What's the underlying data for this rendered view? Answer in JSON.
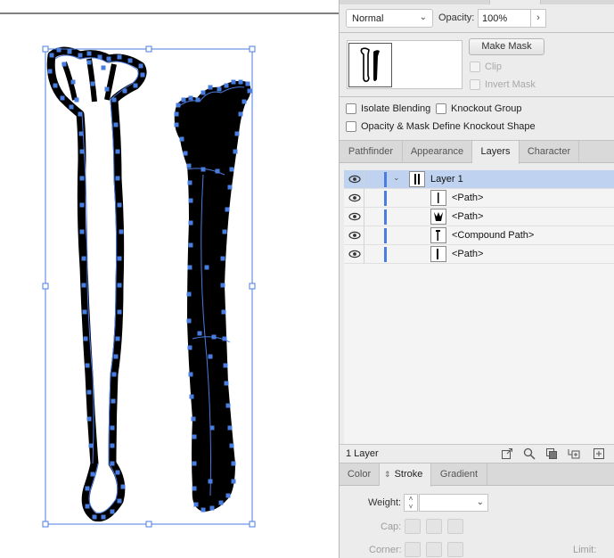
{
  "blend": {
    "mode": "Normal",
    "opacity_label": "Opacity:",
    "opacity_value": "100%"
  },
  "mask": {
    "make_mask_label": "Make Mask",
    "clip_label": "Clip",
    "invert_mask_label": "Invert Mask"
  },
  "options": {
    "isolate_blending": "Isolate Blending",
    "knockout_group": "Knockout Group",
    "opacity_mask_knockout": "Opacity & Mask Define Knockout Shape"
  },
  "tabs_mid": [
    "Pathfinder",
    "Appearance",
    "Layers",
    "Character"
  ],
  "tabs_mid_active": "Layers",
  "layers": {
    "rows": [
      {
        "name": "Layer 1"
      },
      {
        "name": "<Path>"
      },
      {
        "name": "<Path>"
      },
      {
        "name": "<Compound Path>"
      },
      {
        "name": "<Path>"
      }
    ],
    "count_label": "1 Layer"
  },
  "tabs_bottom": [
    "Color",
    "Stroke",
    "Gradient"
  ],
  "tabs_bottom_active": "Stroke",
  "stroke": {
    "weight_label": "Weight:",
    "cap_label": "Cap:",
    "corner_label": "Corner:",
    "limit_label": "Limit:"
  },
  "colors": {
    "selection_blue": "#4a7de0",
    "row_selected": "#bfd3f0",
    "panel_bg": "#ececec"
  }
}
